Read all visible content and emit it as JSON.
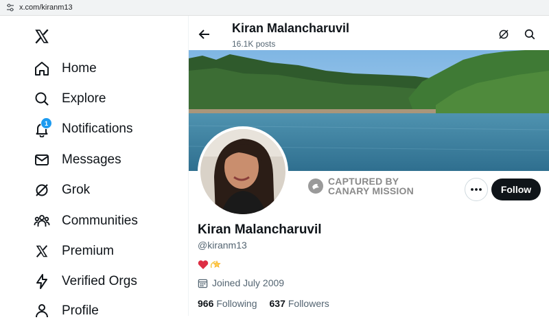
{
  "browser": {
    "url": "x.com/kiranm13"
  },
  "sidebar": {
    "logo_icon": "x-logo-icon",
    "items": [
      {
        "label": "Home",
        "icon": "home-icon"
      },
      {
        "label": "Explore",
        "icon": "search-icon"
      },
      {
        "label": "Notifications",
        "icon": "bell-icon",
        "badge": "1"
      },
      {
        "label": "Messages",
        "icon": "mail-icon"
      },
      {
        "label": "Grok",
        "icon": "grok-icon"
      },
      {
        "label": "Communities",
        "icon": "people-icon"
      },
      {
        "label": "Premium",
        "icon": "x-logo-icon"
      },
      {
        "label": "Verified Orgs",
        "icon": "lightning-icon"
      },
      {
        "label": "Profile",
        "icon": "person-icon"
      }
    ]
  },
  "header": {
    "name": "Kiran Malancharuvil",
    "posts": "16.1K posts"
  },
  "watermark": {
    "line1": "CAPTURED BY",
    "line2": "CANARY MISSION"
  },
  "actions": {
    "follow_label": "Follow"
  },
  "profile": {
    "name": "Kiran Malancharuvil",
    "handle": "@kiranm13",
    "joined": "Joined July 2009",
    "following_count": "966",
    "following_label": "Following",
    "followers_count": "637",
    "followers_label": "Followers"
  },
  "colors": {
    "accent": "#1d9bf0",
    "text": "#0f1419",
    "muted": "#536471",
    "follow_bg": "#0f1419"
  }
}
